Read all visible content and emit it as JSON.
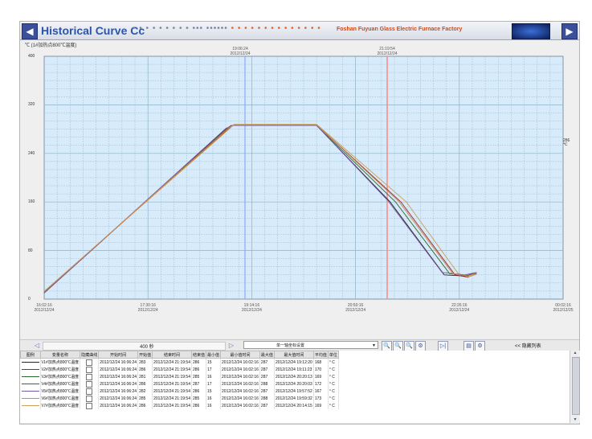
{
  "title": "Historical Curve Cc",
  "factory": "Foshan Fuyuan Glass Electric Furnace Factory",
  "nav": {
    "prev": "◀",
    "next": "▶"
  },
  "dots_blue": "• • • • • • • • •  ••• ••••••",
  "dots_orange": "• • • • • • • • • • • • • •",
  "chart": {
    "unit_label": "℃ (1#加热点800℃温度)",
    "right_label": "286\n℃",
    "cursor_labels": [
      {
        "time": "19:06:24",
        "date": "2012/12/24"
      },
      {
        "time": "21:19:54",
        "date": "2012/12/24"
      }
    ],
    "grid_color": "#8bb2c8",
    "bg_color": "#d8ebfa"
  },
  "chart_data": {
    "type": "line",
    "ylim": [
      0,
      400
    ],
    "yticks": [
      "400",
      "320",
      "240",
      "160",
      "80",
      "0"
    ],
    "xticks": [
      {
        "time": "16:02:16",
        "date": "2012/12/24"
      },
      {
        "time": "17:30:16",
        "date": "2012/12/24"
      },
      {
        "time": "19:14:16",
        "date": "2012/12/24"
      },
      {
        "time": "20:50:16",
        "date": "2012/12/24"
      },
      {
        "time": "22:26:16",
        "date": "2012/12/24"
      },
      {
        "time": "00:02:16",
        "date": "2012/12/25"
      }
    ],
    "x_range_minutes": [
      0,
      480
    ],
    "series": [
      {
        "color": "#222222",
        "points": [
          [
            0,
            10
          ],
          [
            168,
            280
          ],
          [
            173,
            286
          ],
          [
            252,
            286
          ],
          [
            320,
            160
          ],
          [
            370,
            40
          ],
          [
            390,
            38
          ],
          [
            400,
            44
          ]
        ]
      },
      {
        "color": "#9a2a2a",
        "points": [
          [
            0,
            12
          ],
          [
            170,
            280
          ],
          [
            175,
            287
          ],
          [
            252,
            287
          ],
          [
            330,
            160
          ],
          [
            380,
            40
          ],
          [
            392,
            36
          ],
          [
            400,
            42
          ]
        ]
      },
      {
        "color": "#2f6a2f",
        "points": [
          [
            0,
            11
          ],
          [
            169,
            280
          ],
          [
            174,
            286
          ],
          [
            252,
            286
          ],
          [
            325,
            160
          ],
          [
            375,
            42
          ],
          [
            391,
            39
          ],
          [
            400,
            43
          ]
        ]
      },
      {
        "color": "#c8a25a",
        "points": [
          [
            0,
            13
          ],
          [
            171,
            280
          ],
          [
            176,
            288
          ],
          [
            252,
            288
          ],
          [
            335,
            160
          ],
          [
            383,
            42
          ],
          [
            393,
            37
          ],
          [
            400,
            41
          ]
        ]
      },
      {
        "color": "#7a5aa8",
        "points": [
          [
            0,
            10
          ],
          [
            168,
            281
          ],
          [
            174,
            286
          ],
          [
            252,
            286
          ],
          [
            318,
            162
          ],
          [
            368,
            44
          ],
          [
            389,
            40
          ],
          [
            400,
            44
          ]
        ]
      },
      {
        "color": "#d08a50",
        "points": [
          [
            0,
            12
          ],
          [
            170,
            281
          ],
          [
            175,
            287
          ],
          [
            252,
            287
          ],
          [
            328,
            161
          ],
          [
            378,
            42
          ],
          [
            392,
            38
          ],
          [
            400,
            43
          ]
        ]
      }
    ]
  },
  "controls": {
    "scroll_left": "◁",
    "scroll_right": "▷",
    "scroll_value": "400 秒",
    "select_value": "单一轴坐标设置",
    "dropdown": "▼",
    "tools": [
      "🔍",
      "🔍",
      "🔍",
      "⚙",
      "▷|",
      "▤",
      "⚙"
    ],
    "hide_list": "<< 隐藏列表"
  },
  "table": {
    "headers": [
      "图例",
      "变量名称",
      "隐藏曲线",
      "开始时间",
      "开始值",
      "结束时间",
      "结束值",
      "最小值",
      "最小值时间",
      "最大值",
      "最大值时间",
      "平均值",
      "单位"
    ],
    "rows": [
      {
        "color": "#222222",
        "name": "\\\\1#加热点800℃温度",
        "start": "2012/12/24 16:06:24",
        "sv": "283",
        "end": "2012/12/24 21:19:54",
        "ev": "286",
        "min": "15",
        "mint": "2012/12/24 16:02:16",
        "max": "287",
        "maxt": "2012/12/24 19:12:20",
        "avg": "168",
        "unit": "° C"
      },
      {
        "color": "#9a2a2a",
        "name": "\\\\2#加热点800℃温度",
        "start": "2012/12/24 16:06:24",
        "sv": "286",
        "end": "2012/12/24 21:19:54",
        "ev": "286",
        "min": "17",
        "mint": "2012/12/24 16:02:16",
        "max": "287",
        "maxt": "2012/12/24 19:11:23",
        "avg": "170",
        "unit": "° C"
      },
      {
        "color": "#2f6a2f",
        "name": "\\\\3#加热点800℃温度",
        "start": "2012/12/24 16:06:24",
        "sv": "281",
        "end": "2012/12/24 21:19:54",
        "ev": "285",
        "min": "16",
        "mint": "2012/12/24 16:02:16",
        "max": "287",
        "maxt": "2012/12/24 20:20:13",
        "avg": "169",
        "unit": "° C"
      },
      {
        "color": "#555555",
        "name": "\\\\4#加热点800℃温度",
        "start": "2012/12/24 16:06:24",
        "sv": "286",
        "end": "2012/12/24 21:19:54",
        "ev": "287",
        "min": "17",
        "mint": "2012/12/24 16:02:16",
        "max": "288",
        "maxt": "2012/12/24 20:20:03",
        "avg": "172",
        "unit": "° C"
      },
      {
        "color": "#7a5aa8",
        "name": "\\\\5#加热点800℃温度",
        "start": "2012/12/24 16:06:24",
        "sv": "282",
        "end": "2012/12/24 21:19:54",
        "ev": "286",
        "min": "15",
        "mint": "2012/12/24 16:02:16",
        "max": "287",
        "maxt": "2012/12/24 19:57:52",
        "avg": "167",
        "unit": "° C"
      },
      {
        "color": "#d08a50",
        "name": "\\\\6#加热点800℃温度",
        "start": "2012/12/24 16:06:24",
        "sv": "285",
        "end": "2012/12/24 21:19:54",
        "ev": "285",
        "min": "16",
        "mint": "2012/12/24 16:02:16",
        "max": "288",
        "maxt": "2012/12/24 19:59:32",
        "avg": "173",
        "unit": "° C"
      },
      {
        "color": "#c8a25a",
        "name": "\\\\7#加热点800℃温度",
        "start": "2012/12/24 16:06:24",
        "sv": "286",
        "end": "2012/12/24 21:19:54",
        "ev": "286",
        "min": "16",
        "mint": "2012/12/24 16:02:16",
        "max": "287",
        "maxt": "2012/12/24 20:14:15",
        "avg": "169",
        "unit": "° C"
      }
    ]
  }
}
